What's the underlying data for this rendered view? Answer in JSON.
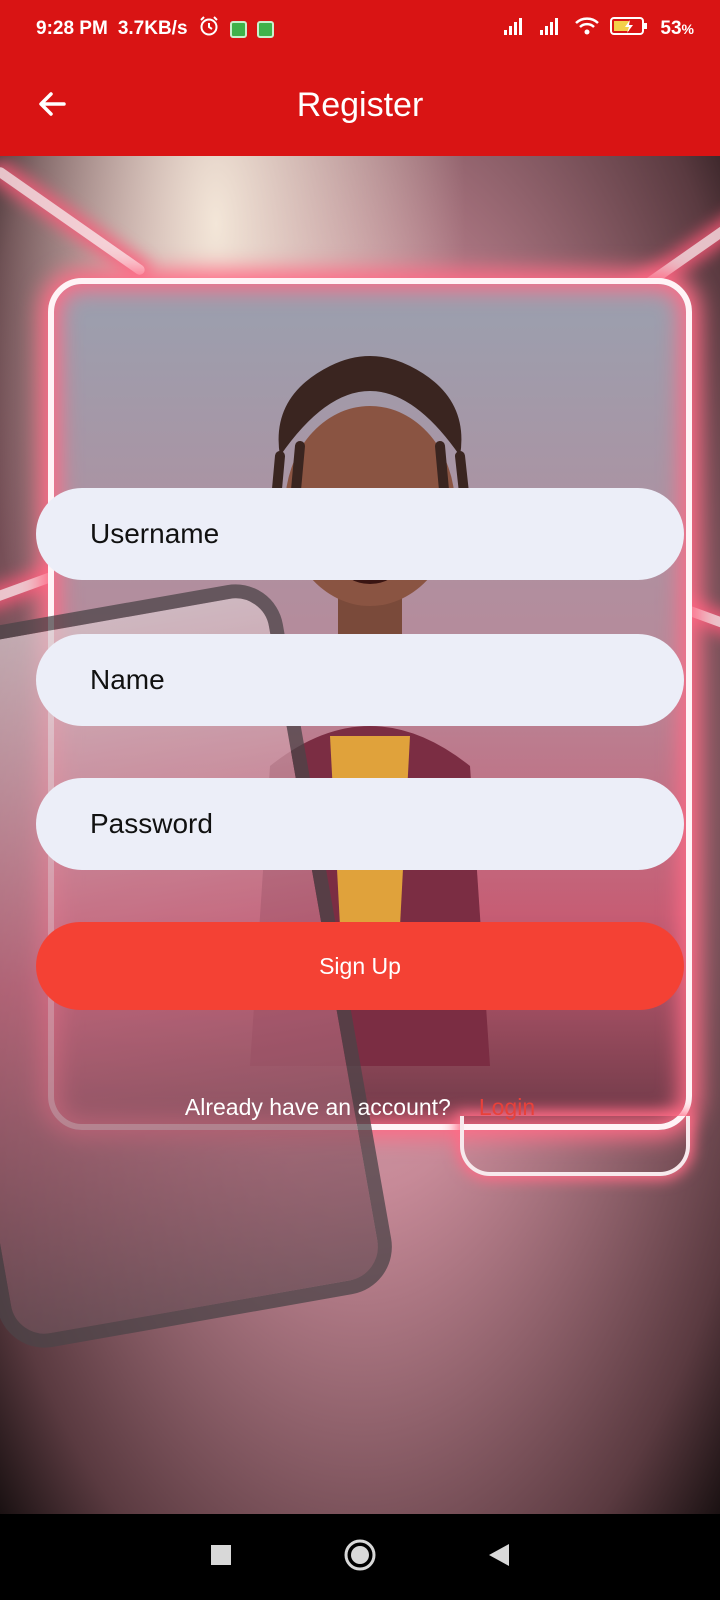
{
  "status_bar": {
    "time": "9:28 PM",
    "speed": "3.7KB/s",
    "battery": "53",
    "battery_unit": "%"
  },
  "app_bar": {
    "title": "Register"
  },
  "form": {
    "username_placeholder": "Username",
    "name_placeholder": "Name",
    "password_placeholder": "Password",
    "signup_label": "Sign Up",
    "login_prompt": "Already have an account?",
    "login_label": "Login"
  },
  "colors": {
    "app_bar": "#d91414",
    "field_bg": "#eceef8",
    "primary_button": "#f44134",
    "link": "#e8413a"
  },
  "icons": {
    "back": "arrow-left",
    "nav_recent": "square",
    "nav_home": "circle",
    "nav_back": "triangle-left"
  }
}
